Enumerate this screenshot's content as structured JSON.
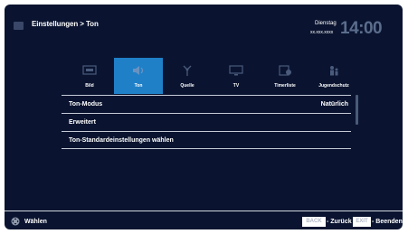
{
  "header": {
    "breadcrumb": "Einstellungen > Ton",
    "day": "Dienstag",
    "date": "xx.xxx.xxxx",
    "time": "14:00"
  },
  "tabs": [
    {
      "label": "Bild",
      "icon": "picture-icon",
      "active": false
    },
    {
      "label": "Ton",
      "icon": "speaker-icon",
      "active": true
    },
    {
      "label": "Quelle",
      "icon": "antenna-icon",
      "active": false
    },
    {
      "label": "TV",
      "icon": "tv-icon",
      "active": false
    },
    {
      "label": "Timerliste",
      "icon": "timer-icon",
      "active": false
    },
    {
      "label": "Jugendschutz",
      "icon": "parental-icon",
      "active": false
    }
  ],
  "menu": {
    "items": [
      {
        "label": "Ton-Modus",
        "value": "Natürlich"
      },
      {
        "label": "Erweitert",
        "value": ""
      },
      {
        "label": "Ton-Standardeinstellungen wählen",
        "value": ""
      }
    ]
  },
  "footer": {
    "select_label": "Wählen",
    "back_key": "BACK",
    "back_label": "Zurück",
    "exit_key": "EXIT",
    "exit_label": "Beenden"
  },
  "colors": {
    "background": "#0a1430",
    "accent": "#1f80c8",
    "divider": "#c5cbd6"
  }
}
